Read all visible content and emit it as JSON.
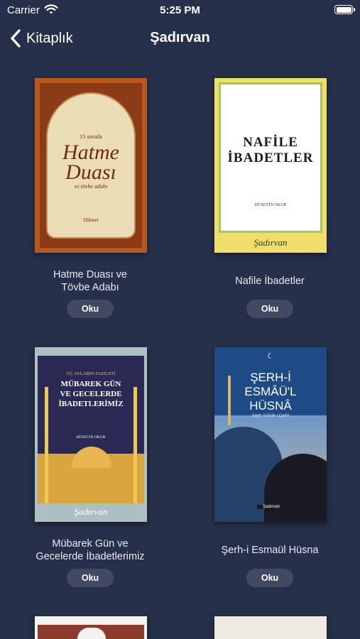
{
  "status_bar": {
    "carrier": "Carrier",
    "time": "5:25 PM"
  },
  "nav": {
    "back_label": "Kitaplık",
    "title": "Şadırvan"
  },
  "books": [
    {
      "title_line1": "Hatme Duası ve",
      "title_line2": "Tövbe Adabı",
      "button": "Oku",
      "cover_top": "15 soruda",
      "cover_title1": "Hatme",
      "cover_title2": "Duası",
      "cover_sub": "ve tövbe adabı",
      "cover_brand": "Hikmet",
      "cover_colors": {
        "frame": "#b9571e",
        "page": "#eadcb4",
        "accent": "#6e2a12"
      }
    },
    {
      "title_line1": "Nafile İbadetler",
      "title_line2": "",
      "button": "Oku",
      "cover_title1": "NAFİLE",
      "cover_title2": "İBADETLER",
      "cover_author": "HÜSEYİN OKUR",
      "cover_brand": "Şadırvan",
      "cover_colors": {
        "frame": "#f0de6a",
        "page": "#ffffff",
        "accent": "#1a1a1a"
      }
    },
    {
      "title_line1": "Mübarek Gün ve",
      "title_line2": "Gecelerde İbadetlerimiz",
      "button": "Oku",
      "cover_top": "ÜÇ AYLARIN FAZİLETİ",
      "cover_title1": "MÜBAREK GÜN",
      "cover_title2": "VE GECELERDE",
      "cover_title3": "İBADETLERİMİZ",
      "cover_author": "HÜSEYİN OKUR",
      "cover_brand": "Şadırvan",
      "cover_colors": {
        "frame": "#aebfc4",
        "page": "#2a2a55",
        "accent": "#f1c75a"
      }
    },
    {
      "title_line1": "Şerh-i Esmaül Hüsna",
      "title_line2": "",
      "button": "Oku",
      "cover_title1": "ŞERH-İ",
      "cover_title2": "ESMÂÜ'L",
      "cover_title3": "HÜSNÂ",
      "cover_sub": "Şeyh Ya'kûb-i Çerhî",
      "cover_brand": "Şadırvan",
      "cover_colors": {
        "frame": "#1e4a85",
        "page": "#3c6eb0",
        "accent": "#ffffff"
      }
    }
  ]
}
